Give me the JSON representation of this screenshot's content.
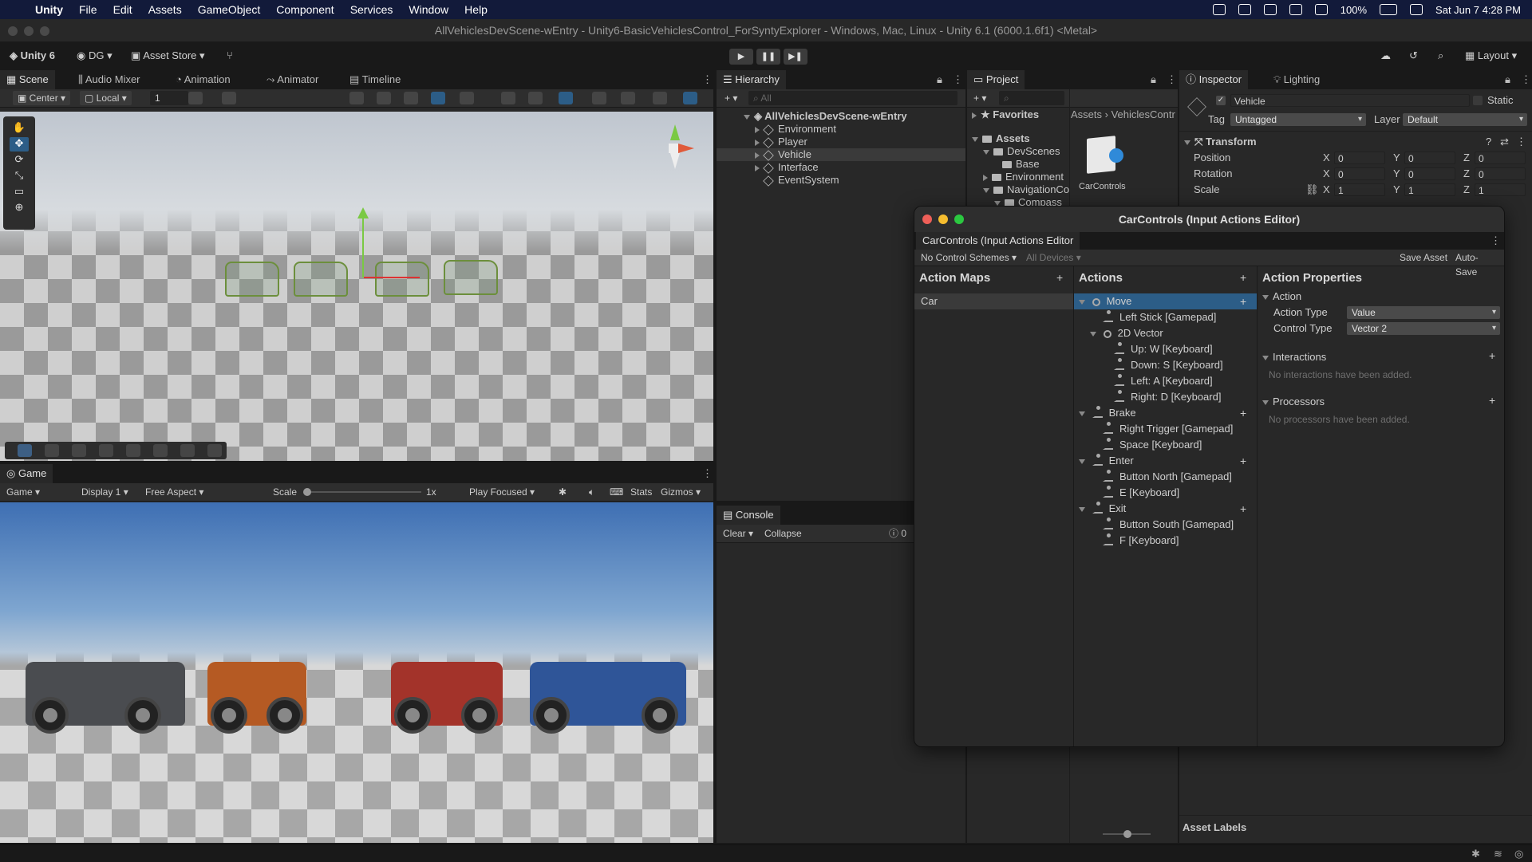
{
  "menubar": {
    "app": "Unity",
    "items": [
      "File",
      "Edit",
      "Assets",
      "GameObject",
      "Component",
      "Services",
      "Window",
      "Help"
    ],
    "battery": "100%",
    "clock": "Sat Jun 7  4:28 PM"
  },
  "window": {
    "title": "AllVehiclesDevScene-wEntry - Unity6-BasicVehiclesControl_ForSyntyExplorer - Windows, Mac, Linux - Unity 6.1 (6000.1.6f1) <Metal>"
  },
  "toolbar": {
    "unity_label": "Unity 6",
    "account": "DG",
    "asset_store": "Asset Store",
    "layout": "Layout"
  },
  "scene_panel": {
    "tabs": [
      "Scene",
      "Audio Mixer",
      "Animation",
      "Animator",
      "Timeline"
    ],
    "pivot": "Center",
    "space": "Local",
    "grid_value": "1"
  },
  "game_panel": {
    "tab": "Game",
    "mode": "Game",
    "display": "Display 1",
    "aspect": "Free Aspect",
    "scale_label": "Scale",
    "scale_value": "1x",
    "play_mode": "Play Focused",
    "stats": "Stats",
    "gizmos": "Gizmos"
  },
  "hierarchy": {
    "tab": "Hierarchy",
    "search_placeholder": "All",
    "scene": "AllVehiclesDevScene-wEntry",
    "items": [
      "Environment",
      "Player",
      "Vehicle",
      "Interface",
      "EventSystem"
    ],
    "selected": "Vehicle"
  },
  "project": {
    "tab": "Project",
    "favorites": "Favorites",
    "assets": "Assets",
    "tree": [
      "DevScenes",
      "Base",
      "Environment",
      "NavigationCo",
      "Compass"
    ],
    "breadcrumb": [
      "Assets",
      "VehiclesContr"
    ],
    "asset_name": "CarControls"
  },
  "inspector": {
    "tab": "Inspector",
    "tab2": "Lighting",
    "object_name": "Vehicle",
    "static_label": "Static",
    "tag_label": "Tag",
    "tag_value": "Untagged",
    "layer_label": "Layer",
    "layer_value": "Default",
    "transform_title": "Transform",
    "rows": [
      {
        "label": "Position",
        "x": "0",
        "y": "0",
        "z": "0"
      },
      {
        "label": "Rotation",
        "x": "0",
        "y": "0",
        "z": "0"
      },
      {
        "label": "Scale",
        "x": "1",
        "y": "1",
        "z": "1"
      }
    ],
    "asset_labels": "Asset Labels"
  },
  "console": {
    "tab": "Console",
    "clear": "Clear",
    "collapse": "Collapse",
    "count": "0"
  },
  "input_editor": {
    "window_title": "CarControls (Input Actions Editor)",
    "tab": "CarControls (Input Actions Editor",
    "schemes": "No Control Schemes",
    "devices": "All Devices",
    "save_asset": "Save Asset",
    "auto_save": "Auto-Save",
    "action_maps_header": "Action Maps",
    "actions_header": "Actions",
    "properties_header": "Action Properties",
    "action_maps": [
      "Car"
    ],
    "actions": [
      {
        "label": "Move",
        "level": 0,
        "kind": "action",
        "selected": true
      },
      {
        "label": "Left Stick [Gamepad]",
        "level": 1,
        "kind": "binding"
      },
      {
        "label": "2D Vector",
        "level": 1,
        "kind": "composite"
      },
      {
        "label": "Up: W [Keyboard]",
        "level": 2,
        "kind": "binding"
      },
      {
        "label": "Down: S [Keyboard]",
        "level": 2,
        "kind": "binding"
      },
      {
        "label": "Left: A [Keyboard]",
        "level": 2,
        "kind": "binding"
      },
      {
        "label": "Right: D [Keyboard]",
        "level": 2,
        "kind": "binding"
      },
      {
        "label": "Brake",
        "level": 0,
        "kind": "action"
      },
      {
        "label": "Right Trigger [Gamepad]",
        "level": 1,
        "kind": "binding"
      },
      {
        "label": "Space [Keyboard]",
        "level": 1,
        "kind": "binding"
      },
      {
        "label": "Enter",
        "level": 0,
        "kind": "action"
      },
      {
        "label": "Button North [Gamepad]",
        "level": 1,
        "kind": "binding"
      },
      {
        "label": "E [Keyboard]",
        "level": 1,
        "kind": "binding"
      },
      {
        "label": "Exit",
        "level": 0,
        "kind": "action"
      },
      {
        "label": "Button South [Gamepad]",
        "level": 1,
        "kind": "binding"
      },
      {
        "label": "F [Keyboard]",
        "level": 1,
        "kind": "binding"
      }
    ],
    "action_section": "Action",
    "action_type_label": "Action Type",
    "action_type_value": "Value",
    "control_type_label": "Control Type",
    "control_type_value": "Vector 2",
    "interactions": "Interactions",
    "interactions_empty": "No interactions have been added.",
    "processors": "Processors",
    "processors_empty": "No processors have been added."
  },
  "colors": {
    "accent": "#2c5d87",
    "selection": "#3a3a3a",
    "panel": "#282828"
  }
}
